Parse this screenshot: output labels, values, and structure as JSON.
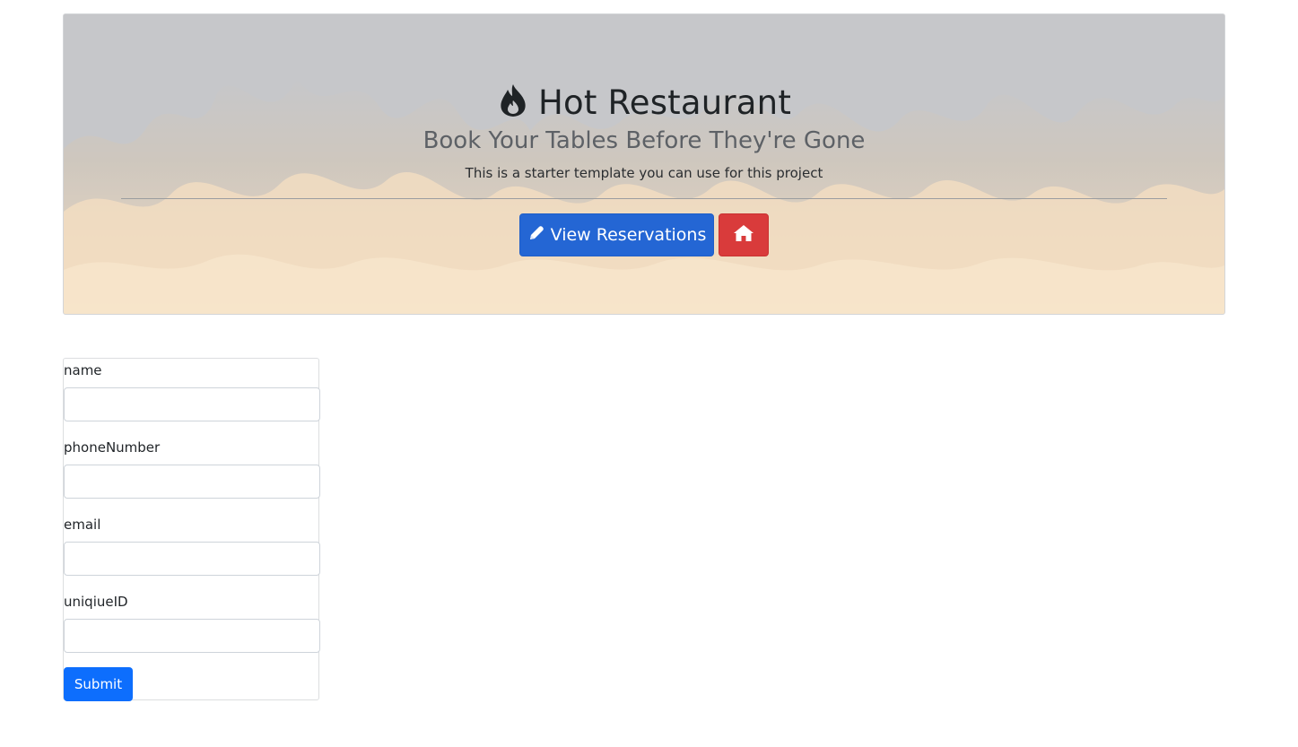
{
  "header": {
    "title": "Hot Restaurant",
    "subtitle": "Book Your Tables Before They're Gone",
    "lead": "This is a starter template you can use for this project",
    "view_reservations_label": "View Reservations",
    "title_icon": "fire-icon",
    "view_icon": "pencil-icon",
    "home_icon": "home-icon"
  },
  "form": {
    "fields": [
      {
        "label": "name",
        "value": ""
      },
      {
        "label": "phoneNumber",
        "value": ""
      },
      {
        "label": "email",
        "value": ""
      },
      {
        "label": "uniqiueID",
        "value": ""
      }
    ],
    "submit_label": "Submit"
  },
  "colors": {
    "primary": "#2466d4",
    "danger": "#d93b3b",
    "submit": "#0d6efd"
  }
}
